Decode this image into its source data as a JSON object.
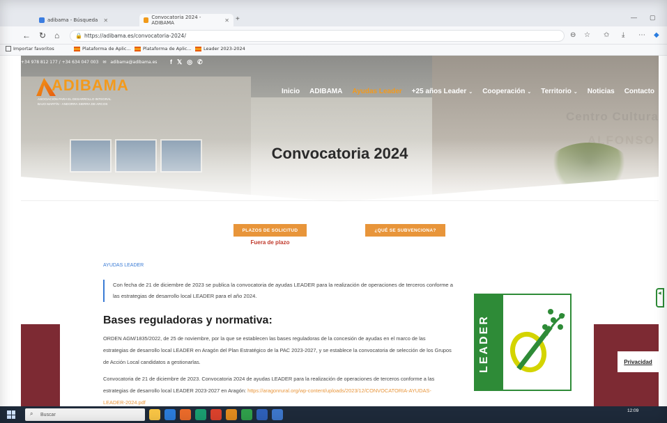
{
  "browser": {
    "tabs": [
      {
        "label": "adibama - Búsqueda"
      },
      {
        "label": "Convocatoria 2024 - ADIBAMA"
      }
    ],
    "url": "https://adibama.es/convocatoria-2024/",
    "favorites": [
      {
        "label": "Importar favoritos"
      },
      {
        "label": "Plataforma de Aplic..."
      },
      {
        "label": "Plataforma de Aplic..."
      },
      {
        "label": "Leader 2023-2024"
      }
    ]
  },
  "site": {
    "phone": "+34 978 812 177 / +34 634 047 003",
    "email": "adibama@adibama.es",
    "logo_name": "ADIBAMA",
    "logo_sub1": "ASOCIACIÓN PARA EL DESARROLLO INTEGRAL",
    "logo_sub2": "BAJO MARTÍN - ANDORRA SIERRA DE ARCOS",
    "building_sign1": "Centro Cultura",
    "building_sign2": "ALFONSO",
    "nav": [
      {
        "label": "Inicio"
      },
      {
        "label": "ADIBAMA"
      },
      {
        "label": "Ayudas Leader"
      },
      {
        "label": "+25 años Leader"
      },
      {
        "label": "Cooperación"
      },
      {
        "label": "Territorio"
      },
      {
        "label": "Noticias"
      },
      {
        "label": "Contacto"
      }
    ],
    "hero_title": "Convocatoria 2024"
  },
  "content": {
    "btn_plazos": "PLAZOS DE SOLICITUD",
    "btn_subvenciona": "¿QUÉ SE SUBVENCIONA?",
    "plazo_status": "Fuera de plazo",
    "breadcrumb": "AYUDAS LEADER",
    "intro": "Con fecha de 21 de diciembre de 2023 se publica la convocatoria de ayudas LEADER para la realización de operaciones de terceros conforme a las estrategias de desarrollo local LEADER para el año 2024.",
    "heading": "Bases reguladoras y normativa:",
    "para1": "ORDEN AGM/1835/2022, de 25 de noviembre, por la que se establecen las bases reguladoras de la concesión de ayudas en el marco de las estrategias de desarrollo local LEADER en Aragón del Plan Estratégico de la PAC 2023-2027, y se establece la convocatoria de selección de los Grupos de Acción Local candidatos a gestionarlas.",
    "para2_text": "Convocatoria de 21 de diciembre de 2023. Convocatoria 2024 de ayudas LEADER para la realización de operaciones de terceros conforme a las estrategias de desarrollo local LEADER 2023-2027 en Aragón: ",
    "para2_link": "https://aragonrural.org/wp-content/uploads/2023/12/CONVOCATORIA-AYUDAS-LEADER-2024.pdf",
    "leader_word": "LEADER",
    "privacy": "Privacidad"
  },
  "taskbar": {
    "search_placeholder": "Buscar",
    "time": "12:09"
  },
  "colors": {
    "accent": "#e8953a",
    "leader_green": "#2e8b37",
    "link_blue": "#3a7bd5",
    "wine": "#7d2a33"
  }
}
